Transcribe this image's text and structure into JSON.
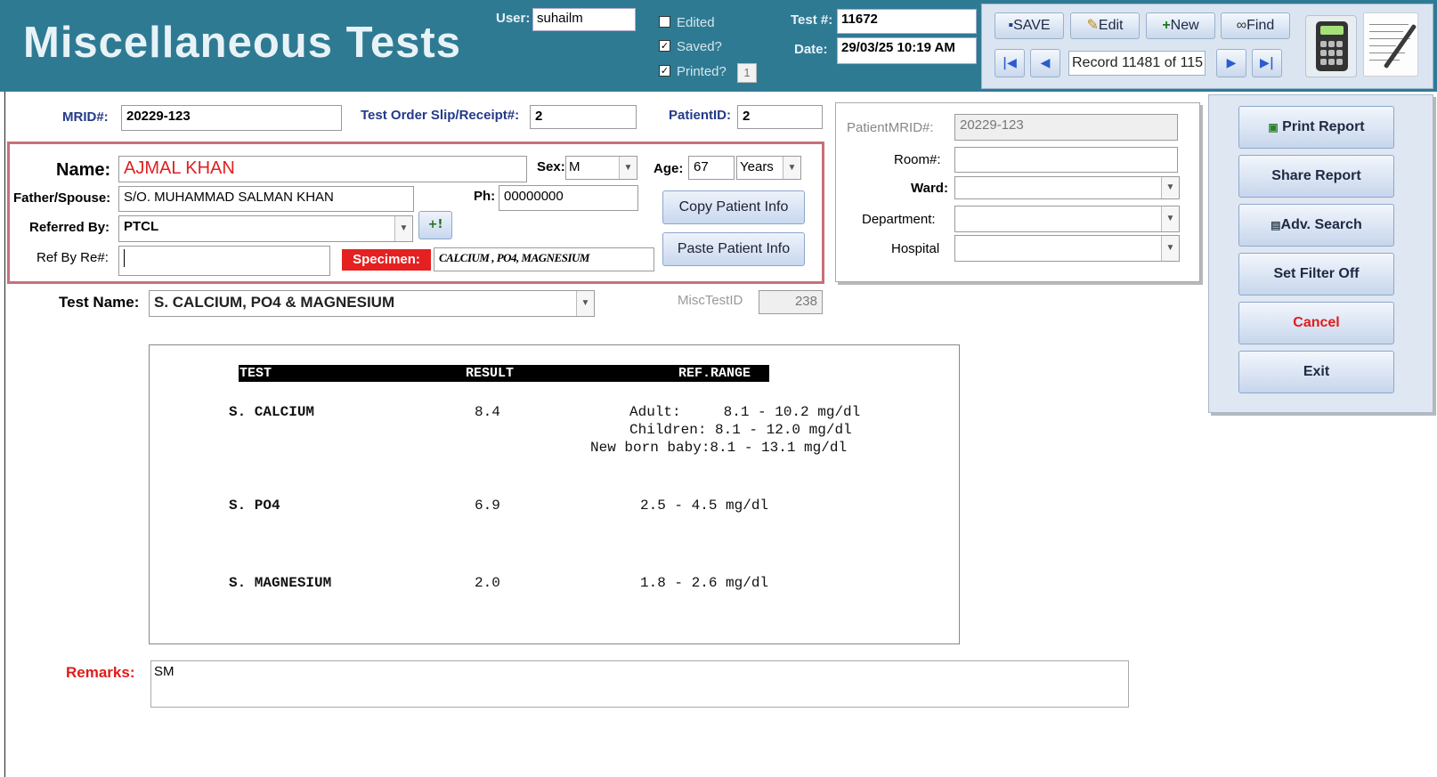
{
  "header": {
    "title": "Miscellaneous Tests",
    "user_label": "User:",
    "user_value": "suhailm",
    "checks": [
      {
        "label": "Edited",
        "checked": false
      },
      {
        "label": "Saved?",
        "checked": true
      },
      {
        "label": "Printed?",
        "checked": true
      }
    ],
    "printed_count": "1",
    "test_no_label": "Test #:",
    "test_no_value": "11672",
    "date_label": "Date:",
    "date_value": "29/03/25 10:19 AM"
  },
  "toolbar": {
    "save_label": "SAVE",
    "edit_label": "Edit",
    "new_label": "New",
    "find_label": "Find",
    "record_text": "Record 11481 of 115"
  },
  "form": {
    "mrid_label": "MRID#:",
    "mrid_value": "20229-123",
    "slip_label": "Test Order Slip/Receipt#:",
    "slip_value": "2",
    "patientid_label": "PatientID:",
    "patientid_value": "2",
    "name_label": "Name:",
    "name_value": "AJMAL KHAN",
    "sex_label": "Sex:",
    "sex_value": "M",
    "age_label": "Age:",
    "age_value": "67",
    "age_unit": "Years",
    "father_label": "Father/Spouse:",
    "father_value": "S/O. MUHAMMAD SALMAN KHAN",
    "ph_label": "Ph:",
    "ph_value": "00000000",
    "referred_label": "Referred By:",
    "referred_value": "PTCL",
    "add_referrer": "+!",
    "copy_btn": "Copy Patient Info",
    "paste_btn": "Paste Patient Info",
    "refby_label": "Ref By Re#:",
    "refby_value": "",
    "specimen_label": "Specimen:",
    "specimen_value": "CALCIUM , PO4, MAGNESIUM",
    "testname_label": "Test Name:",
    "testname_value": "S. CALCIUM, PO4 & MAGNESIUM",
    "misctestid_label": "MiscTestID",
    "misctestid_value": "238",
    "remarks_label": "Remarks:",
    "remarks_value": "SM"
  },
  "right_panel": {
    "patient_mrid_label": "PatientMRID#:",
    "patient_mrid_value": "20229-123",
    "room_label": "Room#:",
    "room_value": "",
    "ward_label": "Ward:",
    "ward_value": "",
    "department_label": "Department:",
    "department_value": "",
    "hospital_label": "Hospital",
    "hospital_value": ""
  },
  "actions": {
    "print_report": "Print Report",
    "share_report": "Share Report",
    "adv_search": "Adv. Search",
    "set_filter_off": "Set Filter Off",
    "cancel": "Cancel",
    "exit": "Exit"
  },
  "results": {
    "headers": [
      "TEST",
      "RESULT",
      "REF.RANGE"
    ],
    "rows": [
      {
        "test": "S. CALCIUM",
        "result": "8.4",
        "range": [
          "Adult:     8.1 - 10.2 mg/dl",
          "Children: 8.1 - 12.0 mg/dl",
          "New born baby:8.1 - 13.1 mg/dl"
        ]
      },
      {
        "test": "S. PO4",
        "result": "6.9",
        "range": [
          "2.5 - 4.5 mg/dl"
        ]
      },
      {
        "test": "S. MAGNESIUM",
        "result": "2.0",
        "range": [
          "1.8 - 2.6 mg/dl"
        ]
      }
    ]
  },
  "colors": {
    "header_bg": "#2f7a93",
    "name_red": "#e02020",
    "label_blue": "#243a8a",
    "cancel_red": "#e01b1b",
    "patient_box_border": "#c8707a"
  },
  "icons": [
    "save-icon",
    "edit-pencil-icon",
    "new-plus-icon",
    "binoculars-icon",
    "first-record-icon",
    "previous-record-icon",
    "next-record-icon",
    "last-record-icon",
    "calculator-icon",
    "notepad-icon",
    "print-icon",
    "search-card-icon"
  ]
}
